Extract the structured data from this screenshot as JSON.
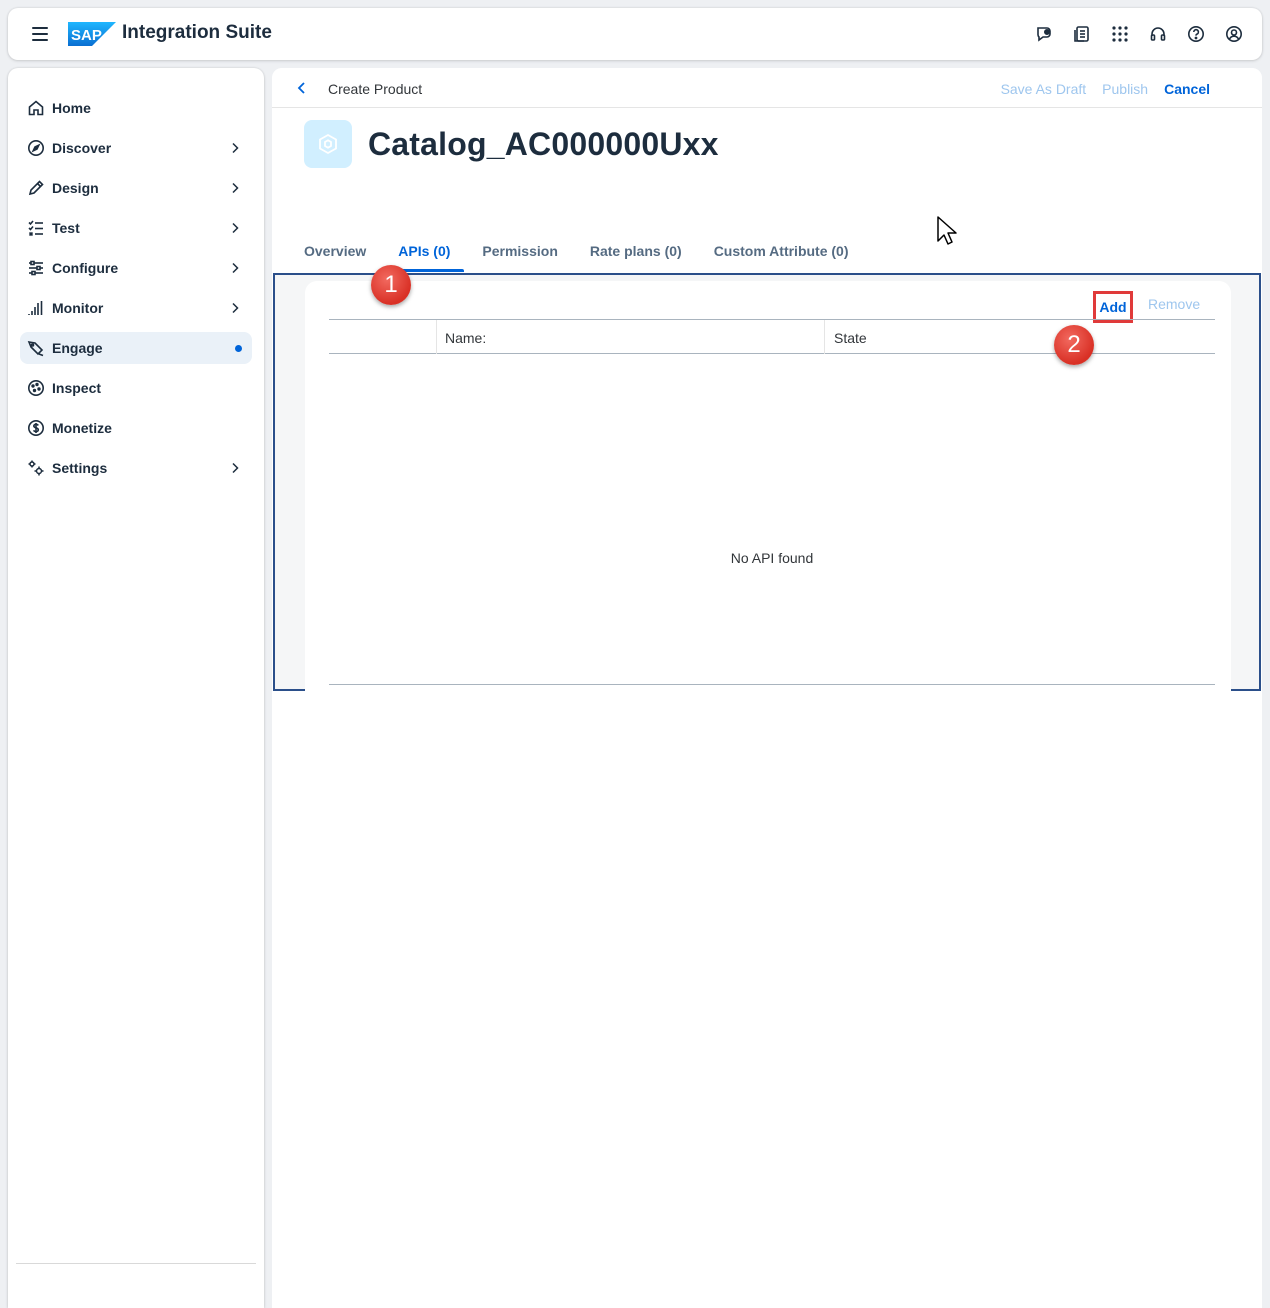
{
  "shell": {
    "product_name": "Integration Suite",
    "logo_text": "SAP",
    "actions": [
      "feedback-icon",
      "notes-icon",
      "apps-grid-icon",
      "support-headset-icon",
      "help-icon",
      "user-profile-icon"
    ]
  },
  "sidenav": {
    "items": [
      {
        "label": "Home",
        "icon": "home-icon",
        "chevron": false
      },
      {
        "label": "Discover",
        "icon": "compass-icon",
        "chevron": true
      },
      {
        "label": "Design",
        "icon": "pencil-icon",
        "chevron": true
      },
      {
        "label": "Test",
        "icon": "checklist-icon",
        "chevron": true
      },
      {
        "label": "Configure",
        "icon": "sliders-icon",
        "chevron": true
      },
      {
        "label": "Monitor",
        "icon": "bar-chart-icon",
        "chevron": true
      },
      {
        "label": "Engage",
        "icon": "engage-icon",
        "chevron": false,
        "active": true
      },
      {
        "label": "Inspect",
        "icon": "inspect-icon",
        "chevron": false
      },
      {
        "label": "Monetize",
        "icon": "dollar-icon",
        "chevron": false
      },
      {
        "label": "Settings",
        "icon": "gears-icon",
        "chevron": true
      }
    ]
  },
  "header": {
    "breadcrumb": "Create Product",
    "actions": {
      "save_draft": "Save As Draft",
      "publish": "Publish",
      "cancel": "Cancel"
    },
    "title": "Catalog_AC000000Uxx"
  },
  "tabs": [
    {
      "label": "Overview"
    },
    {
      "label": "APIs (0)",
      "selected": true
    },
    {
      "label": "Permission"
    },
    {
      "label": "Rate plans (0)"
    },
    {
      "label": "Custom Attribute (0)"
    }
  ],
  "apis": {
    "toolbar": {
      "add": "Add",
      "remove": "Remove"
    },
    "columns": [
      "Name:",
      "State"
    ],
    "empty_text": "No API found"
  },
  "annotations": {
    "step1": "1",
    "step2": "2"
  },
  "colors": {
    "accent": "#0064d9",
    "highlight": "#e03a3a",
    "badge": "#d93025"
  }
}
